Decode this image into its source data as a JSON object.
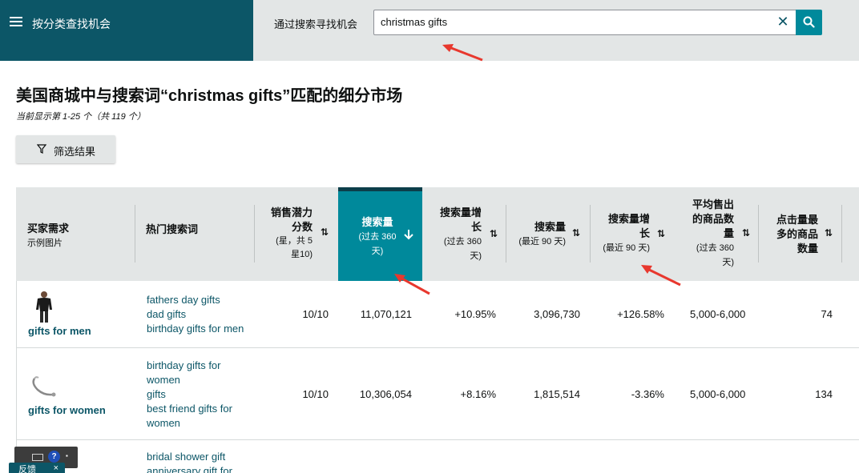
{
  "header": {
    "category_label": "按分类查找机会",
    "search_label": "通过搜索寻找机会",
    "search_value": "christmas gifts",
    "clear_icon": "close-icon",
    "search_icon": "search-icon"
  },
  "page": {
    "title": "美国商城中与搜索词“christmas gifts”匹配的细分市场",
    "result_count": "当前显示第 1-25 个（共 119 个）",
    "filter_label": "筛选结果"
  },
  "table": {
    "columns": [
      {
        "title": "买家需求",
        "sub": "示例图片"
      },
      {
        "title": "热门搜索词",
        "sub": ""
      },
      {
        "title_lines": [
          "销售潜力",
          "分数"
        ],
        "sub_lines": [
          "(星，共 5",
          "星10)"
        ]
      },
      {
        "title_lines": [
          "搜索量"
        ],
        "sub_lines": [
          "(过去 360",
          "天)"
        ]
      },
      {
        "title_lines": [
          "搜索量增",
          "长"
        ],
        "sub_lines": [
          "(过去 360",
          "天)"
        ]
      },
      {
        "title_lines": [
          "搜索量"
        ],
        "sub_lines": [
          "(最近 90 天)"
        ]
      },
      {
        "title_lines": [
          "搜索量增",
          "长"
        ],
        "sub_lines": [
          "(最近 90 天)"
        ]
      },
      {
        "title_lines": [
          "平均售出",
          "的商品数",
          "量"
        ],
        "sub_lines": [
          "(过去 360",
          "天)"
        ]
      },
      {
        "title_lines": [
          "点击量最",
          "多的商品",
          "数量"
        ],
        "sub_lines": []
      }
    ],
    "rows": [
      {
        "need": "gifts for men",
        "terms": [
          "fathers day gifts",
          "dad gifts",
          "birthday gifts for men"
        ],
        "score": "10/10",
        "volume_360": "11,070,121",
        "growth_360": "+10.95%",
        "volume_90": "3,096,730",
        "growth_90": "+126.58%",
        "avg_units": "5,000-6,000",
        "clicked": "74"
      },
      {
        "need": "gifts for women",
        "terms": [
          "birthday gifts for",
          "women",
          "gifts",
          "best friend gifts for",
          "women"
        ],
        "score": "10/10",
        "volume_360": "10,306,054",
        "growth_360": "+8.16%",
        "volume_90": "1,815,514",
        "growth_90": "-3.36%",
        "avg_units": "5,000-6,000",
        "clicked": "134"
      },
      {
        "need": "",
        "terms": [
          "bridal shower gift",
          "anniversary gift for"
        ],
        "score": "",
        "volume_360": "",
        "growth_360": "",
        "volume_90": "",
        "growth_90": "",
        "avg_units": "",
        "clicked": ""
      }
    ]
  },
  "widget": {
    "feedback_label": "反馈",
    "help": "?",
    "close": "×"
  },
  "colors": {
    "header_dark": "#0c5667",
    "accent": "#00899b",
    "header_light": "#e3e6e6",
    "link": "#0c5667",
    "annotation_arrow": "#e8382e"
  }
}
